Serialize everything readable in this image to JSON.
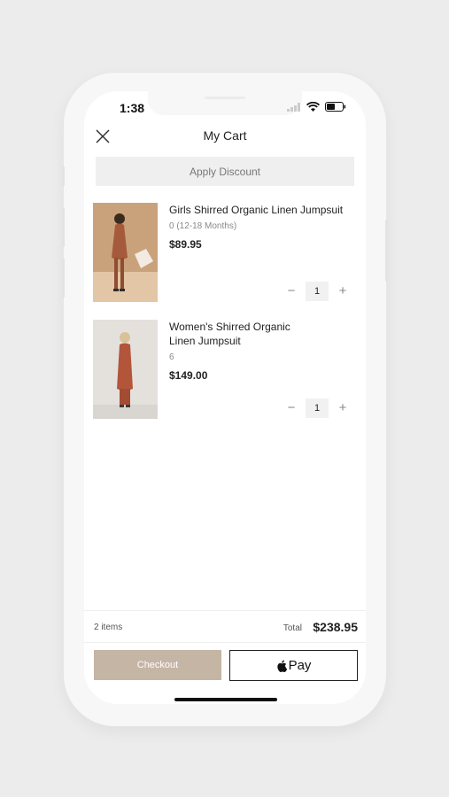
{
  "status_bar": {
    "time": "1:38"
  },
  "header": {
    "title": "My Cart"
  },
  "discount": {
    "label": "Apply Discount"
  },
  "cart_items": [
    {
      "name": "Girls Shirred Organic Linen Jumpsuit",
      "variant": "0 (12-18 Months)",
      "price": "$89.95",
      "quantity": "1",
      "minus": "−",
      "plus": "+"
    },
    {
      "name": "Women's Shirred Organic Linen Jumpsuit",
      "variant": "6",
      "price": "$149.00",
      "quantity": "1",
      "minus": "−",
      "plus": "+"
    }
  ],
  "summary": {
    "item_count": "2 items",
    "total_label": "Total",
    "total_value": "$238.95"
  },
  "actions": {
    "checkout_label": "Checkout",
    "apple_pay_label": "Pay"
  },
  "icons": {
    "close": "close-icon",
    "signal": "signal-icon",
    "wifi": "wifi-icon",
    "battery": "battery-icon",
    "apple": "apple-logo-icon"
  },
  "colors": {
    "checkout_bg": "#c5b5a4",
    "discount_bg": "#efefef",
    "frame": "#f7f7f7"
  }
}
